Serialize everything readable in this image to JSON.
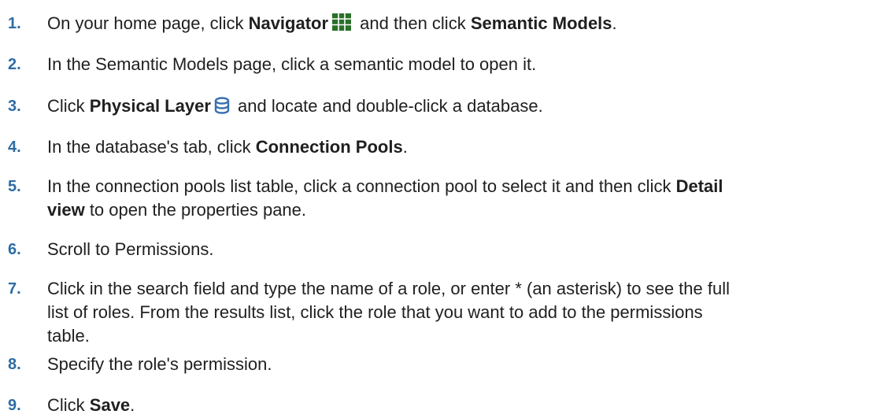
{
  "steps": [
    {
      "num": "1.",
      "t1": "On your home page, click ",
      "b1": "Navigator",
      "t2": " and then click ",
      "b2": "Semantic Models",
      "t3": ".",
      "icon": "grid-icon",
      "icon_color": "#2a6f2a"
    },
    {
      "num": "2.",
      "t1": "In the Semantic Models page, click a semantic model to open it."
    },
    {
      "num": "3.",
      "t1": "Click ",
      "b1": "Physical Layer",
      "t2": " and locate and double-click a database.",
      "icon": "database-icon",
      "icon_color": "#3a6fb0"
    },
    {
      "num": "4.",
      "t1": "In the database's tab, click ",
      "b1": "Connection Pools",
      "t2": "."
    },
    {
      "num": "5.",
      "t1": "In the connection pools list table, click a connection pool to select it and then click ",
      "b1": "Detail",
      "b2": "view",
      "t2": " to open the properties pane."
    },
    {
      "num": "6.",
      "t1": "Scroll to Permissions."
    },
    {
      "num": "7.",
      "l1": "Click in the search field and type the name of a role, or enter * (an asterisk) to see the full",
      "l2": "list of roles. From the results list, click the role that you want to add to the permissions",
      "l3": "table."
    },
    {
      "num": "8.",
      "t1": "Specify the role's permission."
    },
    {
      "num": "9.",
      "t1": "Click ",
      "b1": "Save",
      "t2": "."
    }
  ]
}
